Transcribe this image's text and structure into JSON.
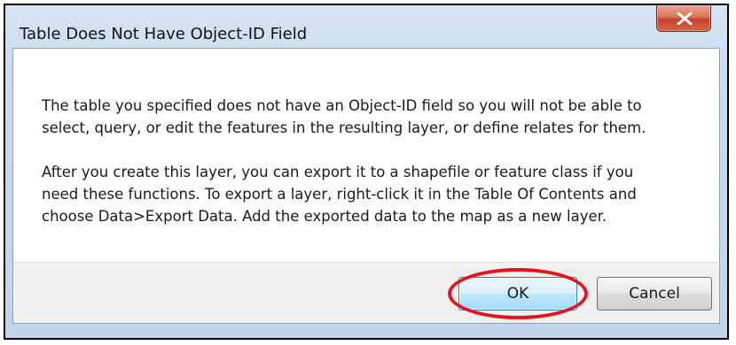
{
  "dialog": {
    "title": "Table Does Not Have Object-ID Field",
    "close_label": "X",
    "message_paragraphs": [
      "The table you specified does not have an Object-ID field so you will not be able to\nselect, query, or edit the features in the resulting layer, or define relates for them.",
      "After you create this layer, you can export it to a shapefile or feature class if you\nneed these functions. To export a layer, right-click it in the Table Of Contents and\nchoose Data>Export Data. Add the exported data to the map as a new layer."
    ]
  },
  "buttons": {
    "ok_label": "OK",
    "cancel_label": "Cancel"
  },
  "annotation": {
    "highlight_color": "#e3141d"
  },
  "icons": {
    "close": "close-icon"
  }
}
